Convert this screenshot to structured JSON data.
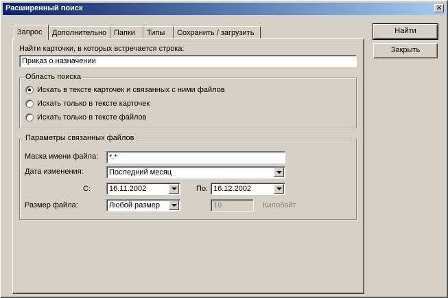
{
  "window": {
    "title": "Расширенный поиск",
    "close_glyph": "✕"
  },
  "tabs": [
    "Запрос",
    "Дополнительно",
    "Папки",
    "Типы",
    "Сохранить / загрузить"
  ],
  "buttons": {
    "find": "Найти",
    "close": "Закрыть"
  },
  "query": {
    "label": "Найти карточки, в которых встречается строка:",
    "value": "Приказ о назначении"
  },
  "search_area": {
    "title": "Область поиска",
    "options": [
      "Искать в тексте карточек и связанных с ними файлов",
      "Искать только в тексте карточек",
      "Искать только в тексте файлов"
    ],
    "selected": 0
  },
  "files": {
    "title": "Параметры связанных файлов",
    "mask_label": "Маска имени файла:",
    "mask_value": "*.*",
    "date_label": "Дата изменения:",
    "date_value": "Последний месяц",
    "from_label": "С:",
    "from_value": "16.11.2002",
    "to_label": "По:",
    "to_value": "16.12.2002",
    "size_label": "Размер файла:",
    "size_value": "Любой размер",
    "size_num": "10",
    "size_unit": "Килобайт"
  }
}
